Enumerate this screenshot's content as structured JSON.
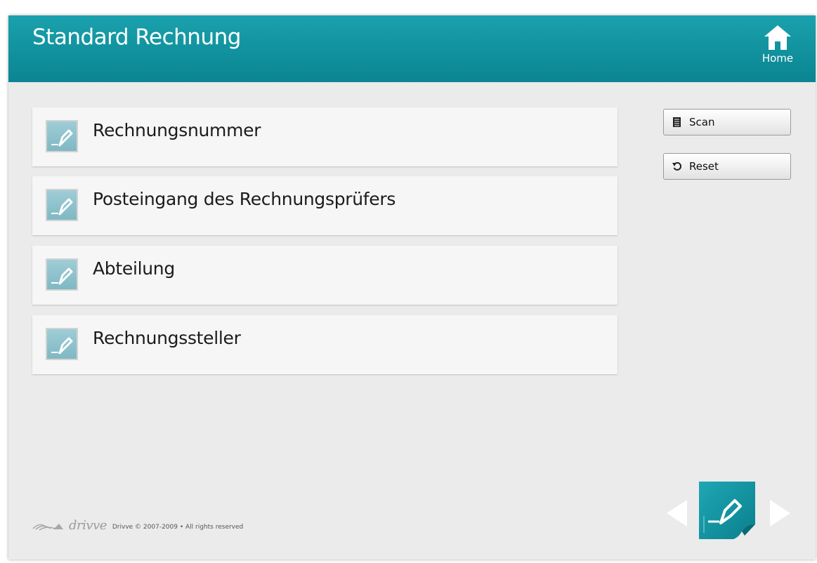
{
  "header": {
    "title": "Standard Rechnung",
    "home_label": "Home"
  },
  "fields": [
    {
      "label": "Rechnungsnummer",
      "icon": "edit-field-icon"
    },
    {
      "label": "Posteingang des Rechnungsprüfers",
      "icon": "edit-field-icon"
    },
    {
      "label": "Abteilung",
      "icon": "edit-field-icon"
    },
    {
      "label": "Rechnungssteller",
      "icon": "edit-field-icon"
    }
  ],
  "actions": {
    "scan_label": "Scan",
    "scan_icon": "document-icon",
    "reset_label": "Reset",
    "reset_icon": "reset-icon"
  },
  "footer": {
    "brand": "drivve",
    "copyright": "Drivve © 2007-2009 • All rights reserved"
  },
  "colors": {
    "header": "#0f919d",
    "background": "#ebebeb",
    "field": "#f6f6f6"
  }
}
